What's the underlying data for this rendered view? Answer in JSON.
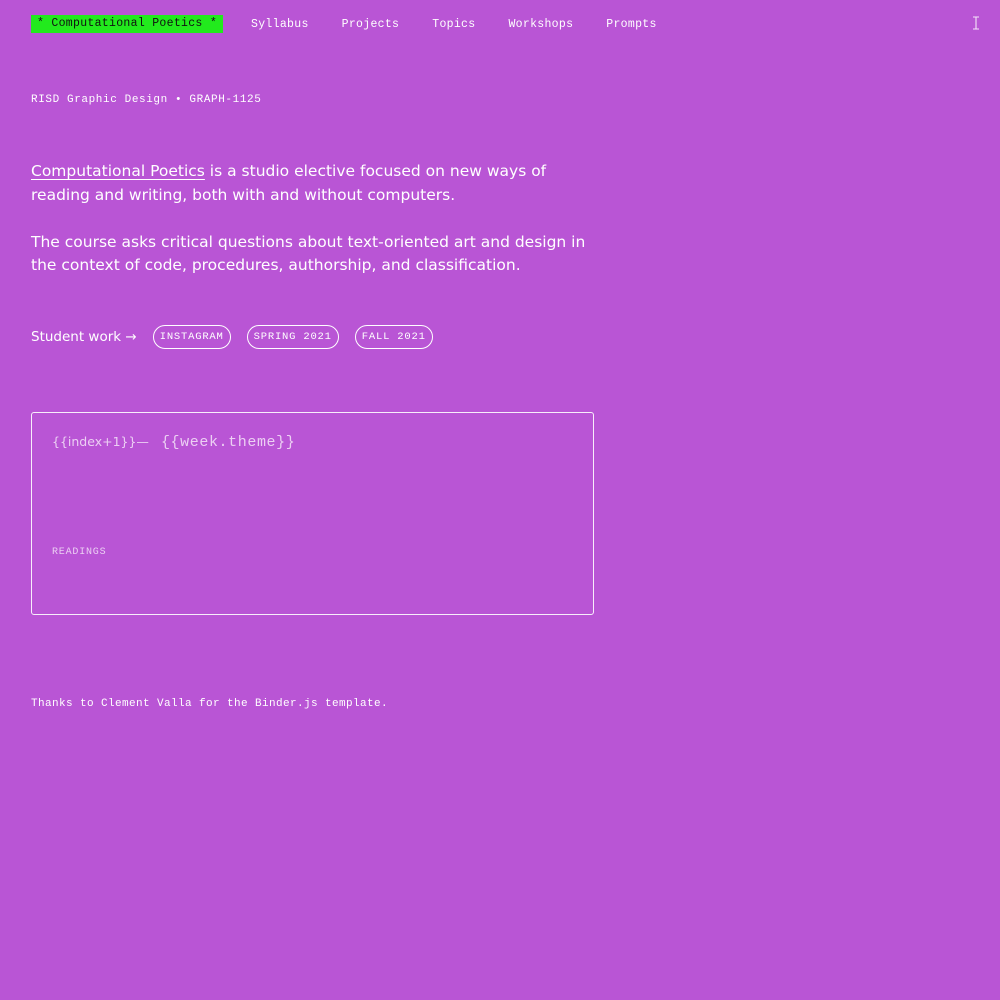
{
  "nav": {
    "brand": "* Computational Poetics *",
    "links": [
      "Syllabus",
      "Projects",
      "Topics",
      "Workshops",
      "Prompts"
    ]
  },
  "subtitle": "RISD Graphic Design • GRAPH-1125",
  "intro": {
    "link_text": "Computational Poetics",
    "line1_rest": " is a studio elective focused on new ways of reading and writing, both with and without computers.",
    "paragraph2": "The course asks critical questions about text-oriented art and design in the context of code, procedures, authorship, and classification."
  },
  "student_work": {
    "label": "Student work →",
    "pills": [
      "INSTAGRAM",
      "SPRING 2021",
      "FALL 2021"
    ]
  },
  "week_card": {
    "index": "{{index+1}}—",
    "theme": "{{week.theme}}",
    "readings_label": "READINGS"
  },
  "footer": "Thanks to Clement Valla for the Binder.js template.",
  "icons": {
    "cursor": "text-cursor-icon"
  },
  "colors": {
    "background": "#b955d5",
    "brand_highlight": "#22ea1d",
    "text": "#ffffff"
  }
}
